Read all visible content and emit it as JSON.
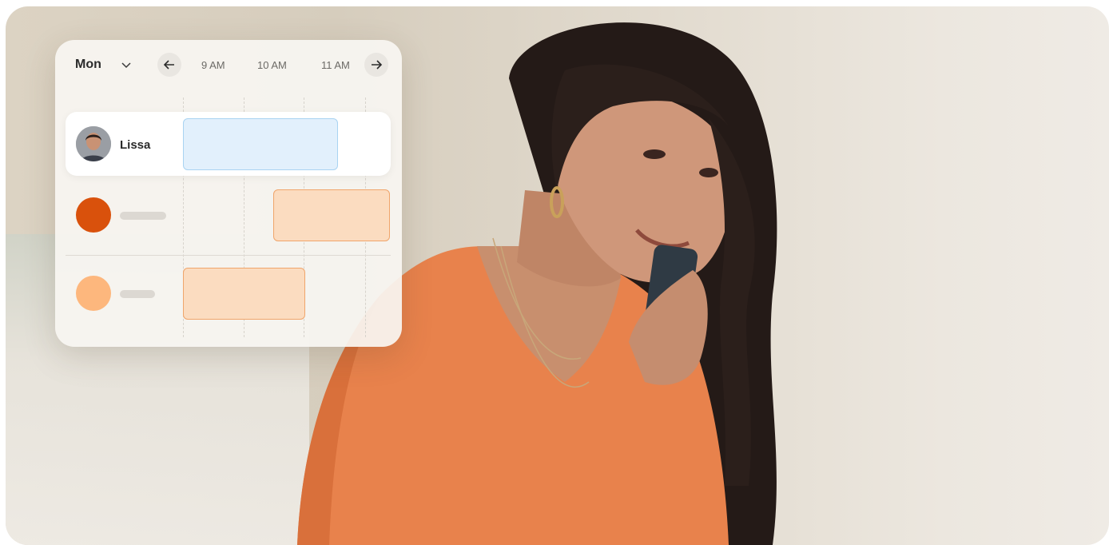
{
  "scheduler": {
    "day_label": "Mon",
    "times": [
      "9 AM",
      "10 AM",
      "11 AM"
    ],
    "rows": [
      {
        "name": "Lissa"
      },
      {
        "name": ""
      },
      {
        "name": ""
      }
    ]
  },
  "colors": {
    "blue_block": "#e2f0fc",
    "orange_block": "#fbdcc0",
    "avatar_orange_dark": "#d9510c",
    "avatar_orange_light": "#fdb77d"
  },
  "icons": [
    "chevron-down-icon",
    "arrow-left-icon",
    "arrow-right-icon"
  ]
}
